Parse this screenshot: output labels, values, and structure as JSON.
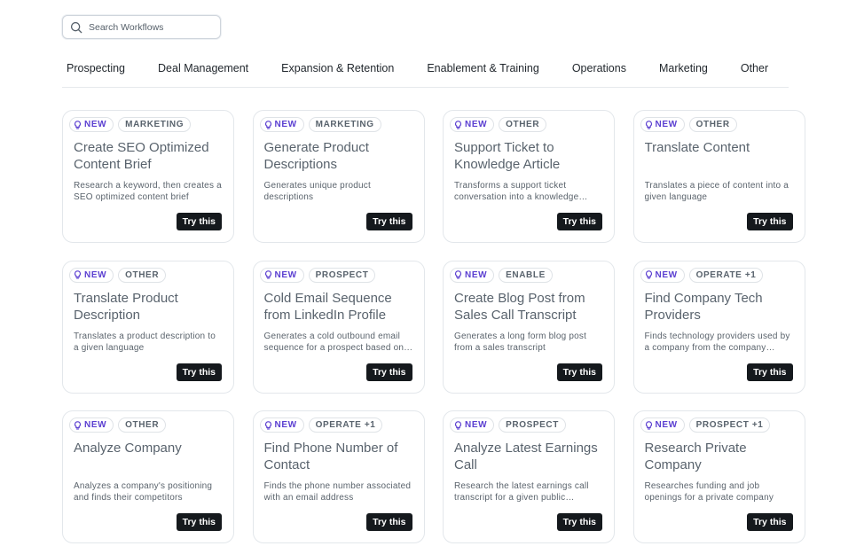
{
  "search": {
    "placeholder": "Search Workflows",
    "value": ""
  },
  "tabs": [
    "Prospecting",
    "Deal Management",
    "Expansion & Retention",
    "Enablement & Training",
    "Operations",
    "Marketing",
    "Other"
  ],
  "colors": {
    "new_tag": "#5b3fd1",
    "button_bg": "#15191d",
    "card_border": "#e3e7eb"
  },
  "cards": [
    {
      "new_label": "NEW",
      "category": "MARKETING",
      "title": "Create SEO Optimized Content Brief",
      "description": "Research a keyword, then creates a SEO optimized content brief",
      "button": "Try this"
    },
    {
      "new_label": "NEW",
      "category": "MARKETING",
      "title": "Generate Product Descriptions",
      "description": "Generates unique product descriptions",
      "button": "Try this"
    },
    {
      "new_label": "NEW",
      "category": "OTHER",
      "title": "Support Ticket to Knowledge Article",
      "description": "Transforms a support ticket conversation into a knowledge article",
      "button": "Try this"
    },
    {
      "new_label": "NEW",
      "category": "OTHER",
      "title": "Translate Content",
      "description": "Translates a piece of content into a given language",
      "button": "Try this"
    },
    {
      "new_label": "NEW",
      "category": "OTHER",
      "title": "Translate Product Description",
      "description": "Translates a product description to a given language",
      "button": "Try this"
    },
    {
      "new_label": "NEW",
      "category": "PROSPECT",
      "title": "Cold Email Sequence from LinkedIn Profile",
      "description": "Generates a cold outbound email sequence for a prospect based on their LinkedIn profile",
      "button": "Try this"
    },
    {
      "new_label": "NEW",
      "category": "ENABLE",
      "title": "Create Blog Post from Sales Call Transcript",
      "description": "Generates a long form blog post from a sales transcript",
      "button": "Try this"
    },
    {
      "new_label": "NEW",
      "category": "OPERATE +1",
      "title": "Find Company Tech Providers",
      "description": "Finds technology providers used by a company from the company website",
      "button": "Try this"
    },
    {
      "new_label": "NEW",
      "category": "OTHER",
      "title": "Analyze Company",
      "description": "Analyzes a company's positioning and finds their competitors",
      "button": "Try this"
    },
    {
      "new_label": "NEW",
      "category": "OPERATE +1",
      "title": "Find Phone Number of Contact",
      "description": "Finds the phone number associated with an email address",
      "button": "Try this"
    },
    {
      "new_label": "NEW",
      "category": "PROSPECT",
      "title": "Analyze Latest Earnings Call",
      "description": "Research the latest earnings call transcript for a given public company",
      "button": "Try this"
    },
    {
      "new_label": "NEW",
      "category": "PROSPECT +1",
      "title": "Research Private Company",
      "description": "Researches funding and job openings for a private company",
      "button": "Try this"
    }
  ]
}
